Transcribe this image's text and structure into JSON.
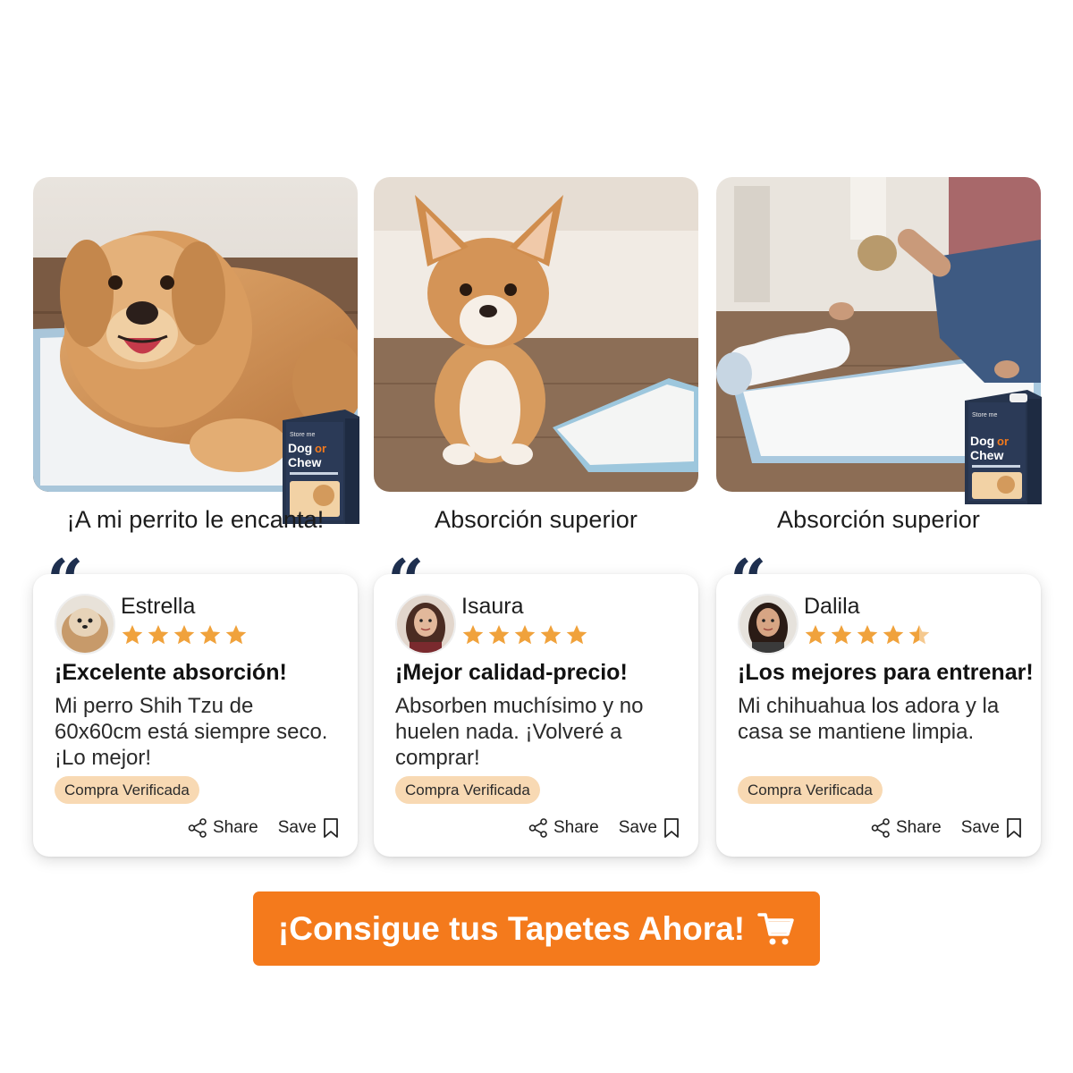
{
  "gallery": [
    {
      "caption": "¡A mi perrito le encanta!"
    },
    {
      "caption": "Absorción superior"
    },
    {
      "caption": "Absorción superior"
    }
  ],
  "product": {
    "brand_line1": "Dog",
    "brand_or": "or",
    "brand_line2": "Chew"
  },
  "reviews": [
    {
      "name": "Estrella",
      "rating": 5,
      "title": "¡Excelente absorción!",
      "text": "Mi perro Shih Tzu de 60x60cm está siempre seco. ¡Lo mejor!",
      "badge": "Compra Verificada",
      "share_label": "Share",
      "save_label": "Save"
    },
    {
      "name": "Isaura",
      "rating": 5,
      "title": "¡Mejor calidad-precio!",
      "text": "Absorben muchísimo y no huelen nada. ¡Volveré a comprar!",
      "badge": "Compra Verificada",
      "share_label": "Share",
      "save_label": "Save"
    },
    {
      "name": "Dalila",
      "rating": 4.5,
      "title": "¡Los mejores para entrenar!",
      "text": "Mi chihuahua los adora y la casa se mantiene limpia.",
      "badge": "Compra Verificada",
      "share_label": "Share",
      "save_label": "Save"
    }
  ],
  "cta": {
    "label": "¡Consigue tus Tapetes Ahora!",
    "icon": "shopping-cart-icon"
  },
  "colors": {
    "accent": "#f47a1c",
    "star": "#f0a23c",
    "badge": "#f8d9b3",
    "quote": "#1f3050"
  }
}
